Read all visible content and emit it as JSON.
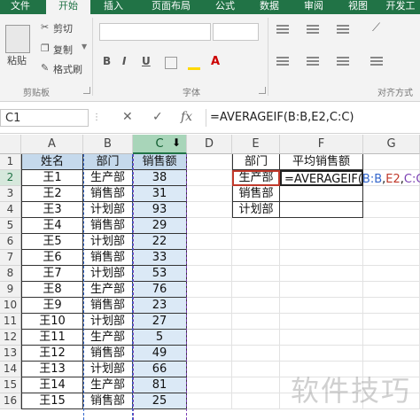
{
  "tabs": [
    "文件",
    "开始",
    "插入",
    "页面布局",
    "公式",
    "数据",
    "审阅",
    "视图",
    "开发工"
  ],
  "ribbon": {
    "cut": "剪切",
    "copy": "复制",
    "format_painter": "格式刷",
    "paste": "粘贴",
    "clipboard_group": "剪贴板",
    "font_group": "字体",
    "align_group": "对齐方式",
    "bold": "B",
    "italic": "I",
    "underline": "U"
  },
  "formula_bar": {
    "name_box": "C1",
    "cancel": "✕",
    "enter": "✓",
    "fx": "fx",
    "formula": "=AVERAGEIF(B:B,E2,C:C)"
  },
  "columns": [
    "A",
    "B",
    "C",
    "D",
    "E",
    "F",
    "G"
  ],
  "rows": [
    "1",
    "2",
    "3",
    "4",
    "5",
    "6",
    "7",
    "8",
    "9",
    "10",
    "11",
    "12",
    "13",
    "14",
    "15",
    "16"
  ],
  "table1": {
    "headers": [
      "姓名",
      "部门",
      "销售额"
    ],
    "rows": [
      [
        "王1",
        "生产部",
        "38"
      ],
      [
        "王2",
        "销售部",
        "31"
      ],
      [
        "王3",
        "计划部",
        "93"
      ],
      [
        "王4",
        "销售部",
        "29"
      ],
      [
        "王5",
        "计划部",
        "22"
      ],
      [
        "王6",
        "销售部",
        "33"
      ],
      [
        "王7",
        "计划部",
        "53"
      ],
      [
        "王8",
        "生产部",
        "76"
      ],
      [
        "王9",
        "销售部",
        "23"
      ],
      [
        "王10",
        "计划部",
        "27"
      ],
      [
        "王11",
        "生产部",
        "5"
      ],
      [
        "王12",
        "销售部",
        "49"
      ],
      [
        "王13",
        "计划部",
        "66"
      ],
      [
        "王14",
        "生产部",
        "81"
      ],
      [
        "王15",
        "销售部",
        "25"
      ]
    ]
  },
  "table2": {
    "headers": [
      "部门",
      "平均销售额"
    ],
    "rows": [
      "生产部",
      "销售部",
      "计划部"
    ],
    "editing": {
      "prefix": "=AVERAGEIF(",
      "ref1": "B:B",
      "sep1": ",",
      "ref2": "E2",
      "sep2": ",",
      "ref3": "C:C",
      "suffix": ")"
    }
  },
  "watermark": "软件技巧"
}
